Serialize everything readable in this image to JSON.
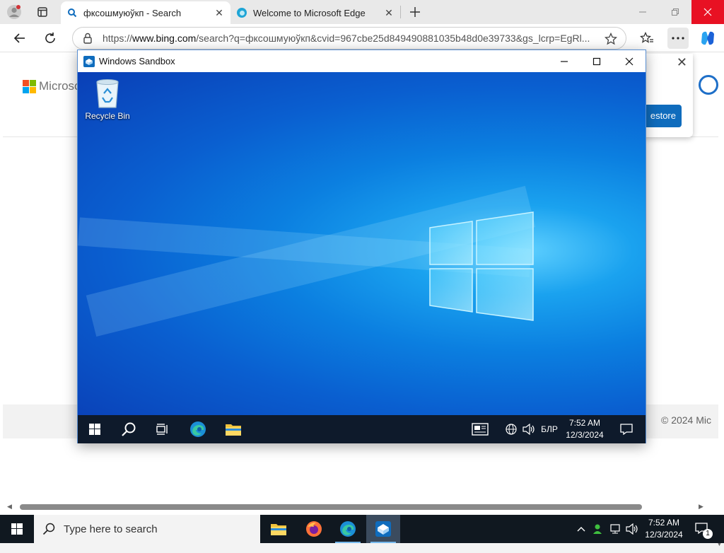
{
  "browser": {
    "tabs": [
      {
        "title": "фксошмуюўкп - Search",
        "favicon": "bing-search-icon",
        "active": true
      },
      {
        "title": "Welcome to Microsoft Edge",
        "favicon": "edge-icon",
        "active": false
      }
    ],
    "address": {
      "prefix": "https://",
      "host": "www.bing.com",
      "rest": "/search?q=фксошмуюўкп&cvid=967cbe25d849490881035b48d0e39733&gs_lcrp=EgRl..."
    }
  },
  "page": {
    "logo_text": "Microsoft",
    "popup_button": "estore",
    "popup_close": "✕",
    "footer_copyright": "© 2024 Mic"
  },
  "sandbox": {
    "title": "Windows Sandbox",
    "desktop_icons": [
      {
        "label": "Recycle Bin"
      }
    ],
    "taskbar": {
      "language": "БЛР",
      "time": "7:52 AM",
      "date": "12/3/2024"
    }
  },
  "taskbar": {
    "search_placeholder": "Type here to search",
    "time": "7:52 AM",
    "date": "12/3/2024",
    "notification_count": "1"
  },
  "colors": {
    "accent": "#0f6cbd",
    "desktop_blue": "#0a5fd0",
    "taskbar": "#101820"
  }
}
